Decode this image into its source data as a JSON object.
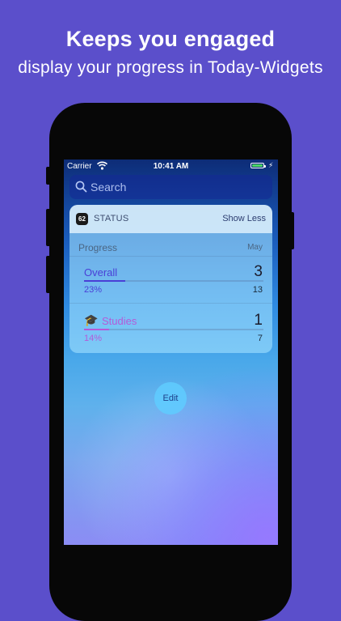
{
  "marketing": {
    "headline": "Keeps you engaged",
    "subline": "display your progress in Today-Widgets"
  },
  "status_bar": {
    "carrier": "Carrier",
    "time": "10:41 AM"
  },
  "search": {
    "placeholder": "Search"
  },
  "widget": {
    "app_icon_text": "62",
    "title": "STATUS",
    "toggle_label": "Show Less",
    "section_label": "Progress",
    "month_label": "May",
    "rows": [
      {
        "emoji": "",
        "label": "Overall",
        "count": "3",
        "percent_text": "23%",
        "total": "13",
        "progress_fraction": 0.23,
        "color": "#4a3fd6"
      },
      {
        "emoji": "🎓",
        "label": "Studies",
        "count": "1",
        "percent_text": "14%",
        "total": "7",
        "progress_fraction": 0.14,
        "color": "#b45bd8"
      }
    ]
  },
  "edit_button": {
    "label": "Edit"
  },
  "colors": {
    "background": "#5b4fcb",
    "overall_accent": "#4a3fd6",
    "studies_accent": "#b45bd8"
  }
}
